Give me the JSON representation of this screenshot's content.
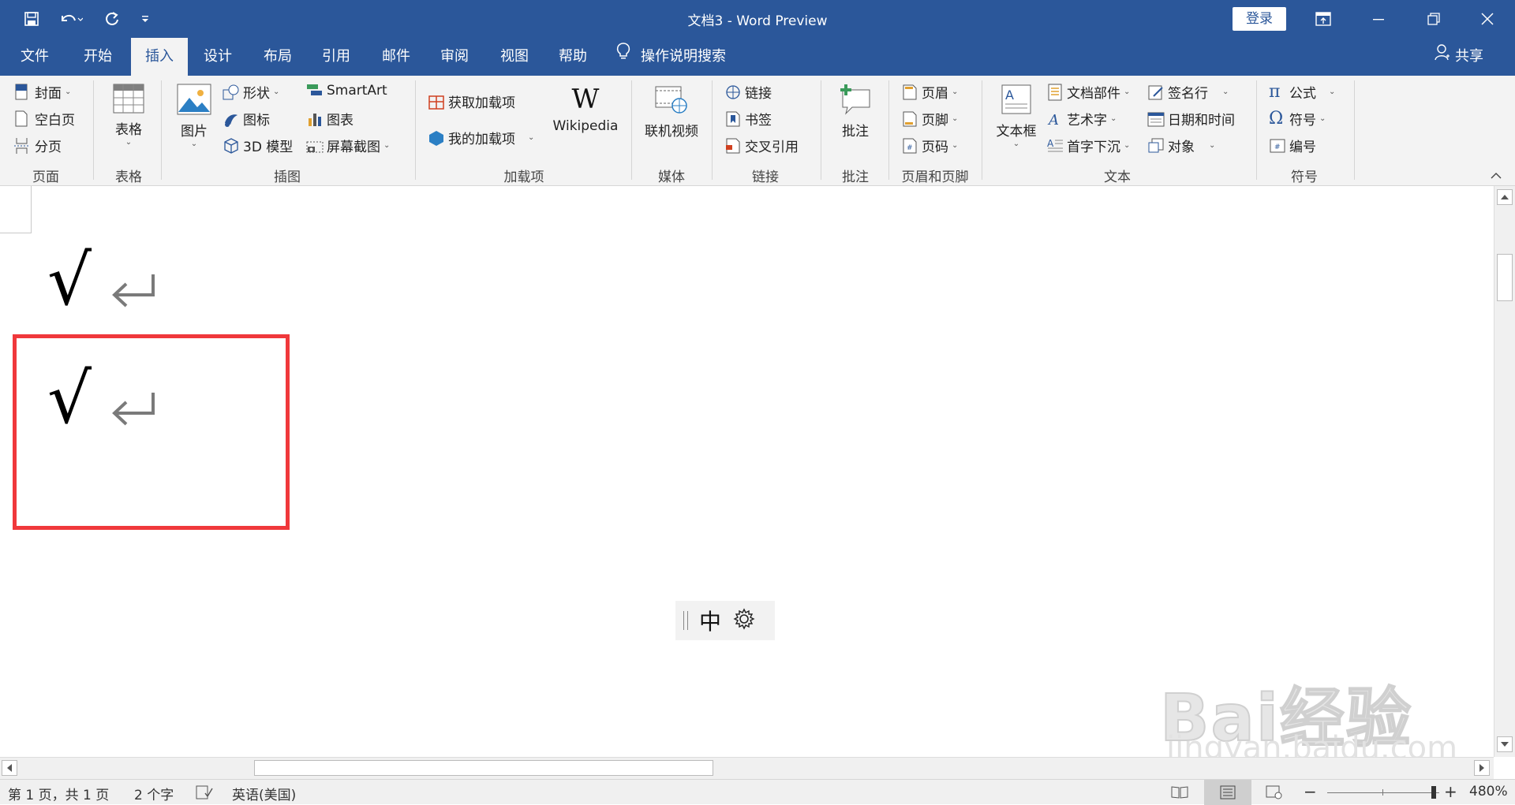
{
  "window": {
    "title": "文档3  -  Word Preview",
    "login_label": "登录"
  },
  "tabs": [
    {
      "label": "文件"
    },
    {
      "label": "开始"
    },
    {
      "label": "插入"
    },
    {
      "label": "设计"
    },
    {
      "label": "布局"
    },
    {
      "label": "引用"
    },
    {
      "label": "邮件"
    },
    {
      "label": "审阅"
    },
    {
      "label": "视图"
    },
    {
      "label": "帮助"
    }
  ],
  "active_tab": "插入",
  "tell_me": "操作说明搜索",
  "share": "共享",
  "ribbon": {
    "pages": {
      "cover": "封面",
      "blank": "空白页",
      "break": "分页",
      "group": "页面"
    },
    "table": {
      "table": "表格",
      "group": "表格"
    },
    "illustrations": {
      "picture": "图片",
      "shapes": "形状",
      "icons": "图标",
      "model3d": "3D 模型",
      "smartart": "SmartArt",
      "chart": "图表",
      "screenshot": "屏幕截图",
      "group": "插图"
    },
    "addins": {
      "get": "获取加载项",
      "mine": "我的加载项",
      "wikipedia": "Wikipedia",
      "group": "加载项"
    },
    "media": {
      "video": "联机视频",
      "group": "媒体"
    },
    "links": {
      "link": "链接",
      "bookmark": "书签",
      "crossref": "交叉引用",
      "group": "链接"
    },
    "comments": {
      "comment": "批注",
      "group": "批注"
    },
    "header_footer": {
      "header": "页眉",
      "footer": "页脚",
      "page_number": "页码",
      "group": "页眉和页脚"
    },
    "text": {
      "textbox": "文本框",
      "quickparts": "文档部件",
      "wordart": "艺术字",
      "dropcap": "首字下沉",
      "signature": "签名行",
      "datetime": "日期和时间",
      "object": "对象",
      "group": "文本"
    },
    "symbols": {
      "equation": "公式",
      "symbol": "符号",
      "number": "编号",
      "group": "符号"
    }
  },
  "document": {
    "line1": "√",
    "line2": "√",
    "ime_mode": "中"
  },
  "highlight_color": "#f0383b",
  "accent_color": "#2b579a",
  "status": {
    "page": "第 1 页，共 1 页",
    "words": "2 个字",
    "language": "英语(美国)",
    "zoom": "480%"
  },
  "watermark": {
    "brand": "Bai经验",
    "url": "jingyan.baidu.com"
  }
}
